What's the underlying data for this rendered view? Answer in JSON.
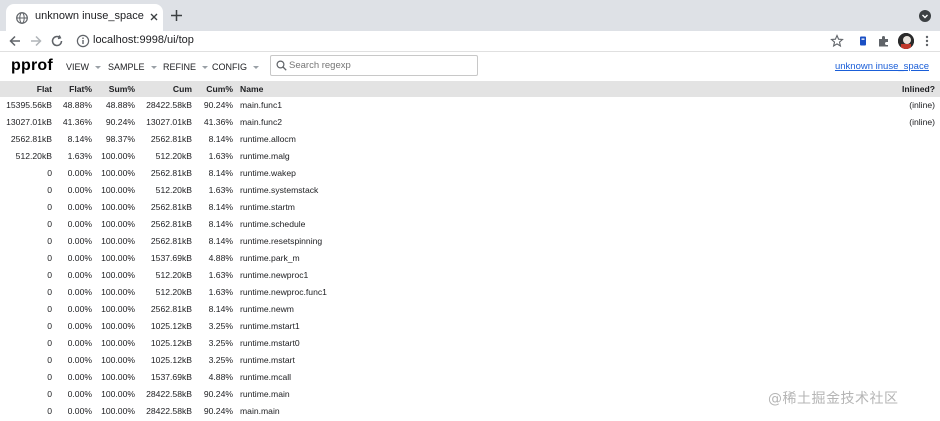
{
  "browser": {
    "tab_title": "unknown inuse_space",
    "url": "localhost:9998/ui/top"
  },
  "app": {
    "logo": "pprof",
    "menus": [
      {
        "label": "VIEW"
      },
      {
        "label": "SAMPLE"
      },
      {
        "label": "REFINE"
      },
      {
        "label": "CONFIG"
      }
    ],
    "search_placeholder": "Search regexp",
    "profile_link": "unknown inuse_space"
  },
  "table": {
    "headers": {
      "flat": "Flat",
      "flat_pct": "Flat%",
      "sum_pct": "Sum%",
      "cum": "Cum",
      "cum_pct": "Cum%",
      "name": "Name",
      "inlined": "Inlined?"
    },
    "rows": [
      {
        "flat": "15395.56kB",
        "flat_pct": "48.88%",
        "sum_pct": "48.88%",
        "cum": "28422.58kB",
        "cum_pct": "90.24%",
        "name": "main.func1",
        "inlined": "(inline)"
      },
      {
        "flat": "13027.01kB",
        "flat_pct": "41.36%",
        "sum_pct": "90.24%",
        "cum": "13027.01kB",
        "cum_pct": "41.36%",
        "name": "main.func2",
        "inlined": "(inline)"
      },
      {
        "flat": "2562.81kB",
        "flat_pct": "8.14%",
        "sum_pct": "98.37%",
        "cum": "2562.81kB",
        "cum_pct": "8.14%",
        "name": "runtime.allocm",
        "inlined": ""
      },
      {
        "flat": "512.20kB",
        "flat_pct": "1.63%",
        "sum_pct": "100.00%",
        "cum": "512.20kB",
        "cum_pct": "1.63%",
        "name": "runtime.malg",
        "inlined": ""
      },
      {
        "flat": "0",
        "flat_pct": "0.00%",
        "sum_pct": "100.00%",
        "cum": "2562.81kB",
        "cum_pct": "8.14%",
        "name": "runtime.wakep",
        "inlined": ""
      },
      {
        "flat": "0",
        "flat_pct": "0.00%",
        "sum_pct": "100.00%",
        "cum": "512.20kB",
        "cum_pct": "1.63%",
        "name": "runtime.systemstack",
        "inlined": ""
      },
      {
        "flat": "0",
        "flat_pct": "0.00%",
        "sum_pct": "100.00%",
        "cum": "2562.81kB",
        "cum_pct": "8.14%",
        "name": "runtime.startm",
        "inlined": ""
      },
      {
        "flat": "0",
        "flat_pct": "0.00%",
        "sum_pct": "100.00%",
        "cum": "2562.81kB",
        "cum_pct": "8.14%",
        "name": "runtime.schedule",
        "inlined": ""
      },
      {
        "flat": "0",
        "flat_pct": "0.00%",
        "sum_pct": "100.00%",
        "cum": "2562.81kB",
        "cum_pct": "8.14%",
        "name": "runtime.resetspinning",
        "inlined": ""
      },
      {
        "flat": "0",
        "flat_pct": "0.00%",
        "sum_pct": "100.00%",
        "cum": "1537.69kB",
        "cum_pct": "4.88%",
        "name": "runtime.park_m",
        "inlined": ""
      },
      {
        "flat": "0",
        "flat_pct": "0.00%",
        "sum_pct": "100.00%",
        "cum": "512.20kB",
        "cum_pct": "1.63%",
        "name": "runtime.newproc1",
        "inlined": ""
      },
      {
        "flat": "0",
        "flat_pct": "0.00%",
        "sum_pct": "100.00%",
        "cum": "512.20kB",
        "cum_pct": "1.63%",
        "name": "runtime.newproc.func1",
        "inlined": ""
      },
      {
        "flat": "0",
        "flat_pct": "0.00%",
        "sum_pct": "100.00%",
        "cum": "2562.81kB",
        "cum_pct": "8.14%",
        "name": "runtime.newm",
        "inlined": ""
      },
      {
        "flat": "0",
        "flat_pct": "0.00%",
        "sum_pct": "100.00%",
        "cum": "1025.12kB",
        "cum_pct": "3.25%",
        "name": "runtime.mstart1",
        "inlined": ""
      },
      {
        "flat": "0",
        "flat_pct": "0.00%",
        "sum_pct": "100.00%",
        "cum": "1025.12kB",
        "cum_pct": "3.25%",
        "name": "runtime.mstart0",
        "inlined": ""
      },
      {
        "flat": "0",
        "flat_pct": "0.00%",
        "sum_pct": "100.00%",
        "cum": "1025.12kB",
        "cum_pct": "3.25%",
        "name": "runtime.mstart",
        "inlined": ""
      },
      {
        "flat": "0",
        "flat_pct": "0.00%",
        "sum_pct": "100.00%",
        "cum": "1537.69kB",
        "cum_pct": "4.88%",
        "name": "runtime.mcall",
        "inlined": ""
      },
      {
        "flat": "0",
        "flat_pct": "0.00%",
        "sum_pct": "100.00%",
        "cum": "28422.58kB",
        "cum_pct": "90.24%",
        "name": "runtime.main",
        "inlined": ""
      },
      {
        "flat": "0",
        "flat_pct": "0.00%",
        "sum_pct": "100.00%",
        "cum": "28422.58kB",
        "cum_pct": "90.24%",
        "name": "main.main",
        "inlined": ""
      }
    ]
  },
  "watermark": "@稀土掘金技术社区",
  "colors": {
    "header_bg": "#e3e3e3",
    "link": "#1a5ed8",
    "tabstrip": "#dee1e6"
  },
  "icons": [
    "globe-icon",
    "close-icon",
    "plus-icon",
    "back-icon",
    "forward-icon",
    "reload-icon",
    "info-icon",
    "star-icon",
    "extension-icon",
    "puzzle-icon",
    "avatar",
    "dropdown-icon",
    "search-icon"
  ]
}
